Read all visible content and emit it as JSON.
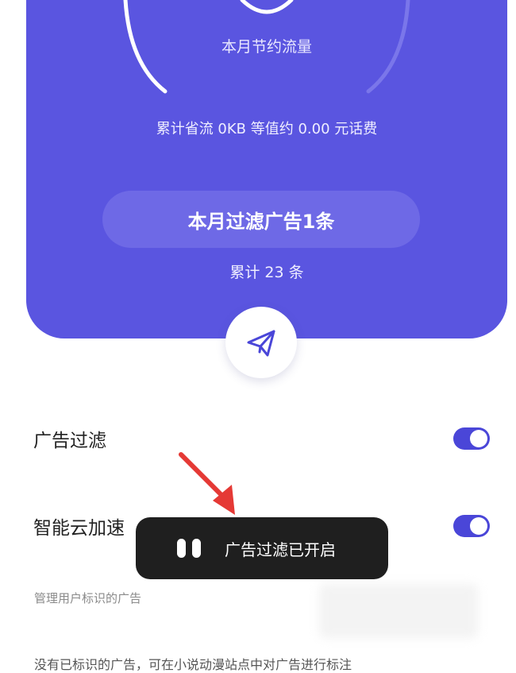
{
  "stats": {
    "saved_label": "本月节约流量",
    "total_saved_text": "累计省流 0KB 等值约 0.00 元话费",
    "filtered_this_month": "本月过滤广告1条",
    "total_count": "累计 23 条"
  },
  "settings": [
    {
      "label": "广告过滤",
      "enabled": true
    },
    {
      "label": "智能云加速",
      "enabled": true
    }
  ],
  "hint": "管理用户标识的广告",
  "note": "没有已标识的广告，可在小说动漫站点中对广告进行标注",
  "toast": {
    "text": "广告过滤已开启"
  },
  "colors": {
    "primary": "#5a55e0",
    "toggle_on": "#4a46d8",
    "toast_bg": "#1f1f1f",
    "arrow": "#e53935"
  },
  "icons": {
    "fab": "paper-plane-icon",
    "toast": "pause-icon"
  }
}
